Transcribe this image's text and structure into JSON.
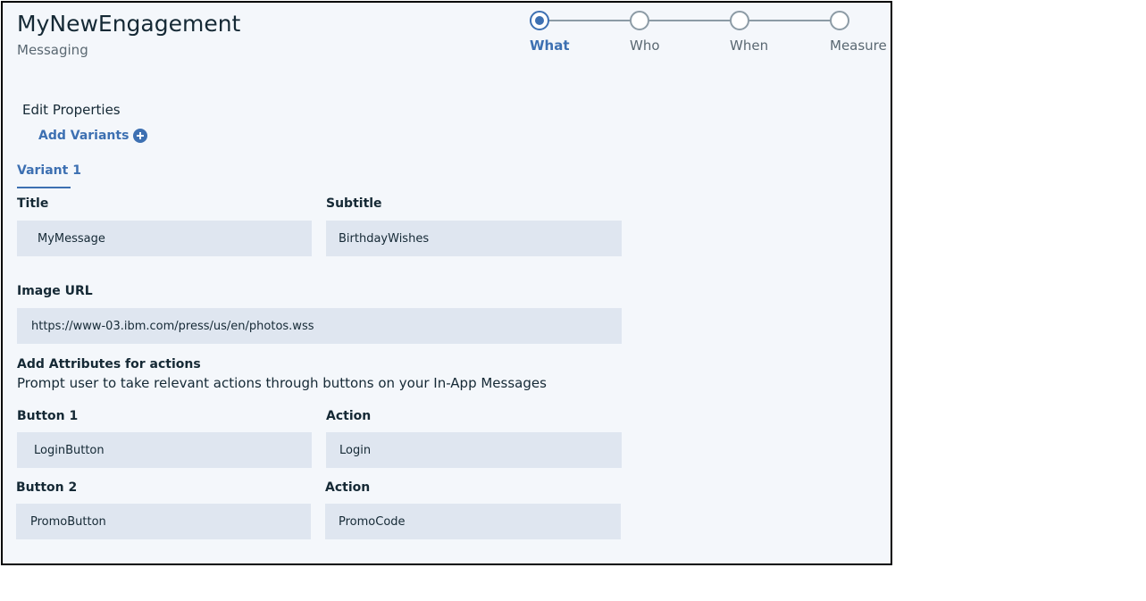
{
  "header": {
    "title": "MyNewEngagement",
    "subtitle": "Messaging"
  },
  "progress": {
    "steps": [
      {
        "label": "What",
        "active": true
      },
      {
        "label": "Who",
        "active": false
      },
      {
        "label": "When",
        "active": false
      },
      {
        "label": "Measure",
        "active": false
      }
    ]
  },
  "content": {
    "heading": "Edit Properties",
    "add_variants_label": "Add Variants",
    "tabs": [
      {
        "label": "Variant 1",
        "selected": true
      }
    ]
  },
  "fields": {
    "title": {
      "label": "Title",
      "value": "MyMessage"
    },
    "subtitle": {
      "label": "Subtitle",
      "value": "BirthdayWishes"
    },
    "image_url": {
      "label": "Image URL",
      "value": "https://www-03.ibm.com/press/us/en/photos.wss"
    }
  },
  "actions_section": {
    "heading": "Add Attributes for actions",
    "helper": "Prompt user to take relevant actions through buttons on your In-App Messages",
    "button1": {
      "label": "Button 1",
      "value": "LoginButton"
    },
    "action1": {
      "label": "Action",
      "value": "Login"
    },
    "button2": {
      "label": "Button 2",
      "value": "PromoButton"
    },
    "action2": {
      "label": "Action",
      "value": "PromoCode"
    }
  },
  "icons": [
    "plus-circle-icon",
    "step-dot-icon"
  ],
  "colors": {
    "accent": "#3d70b2",
    "input_bg": "#dfe6f0",
    "panel_bg": "#f4f7fb",
    "step_inactive": "#8c9ba5"
  }
}
